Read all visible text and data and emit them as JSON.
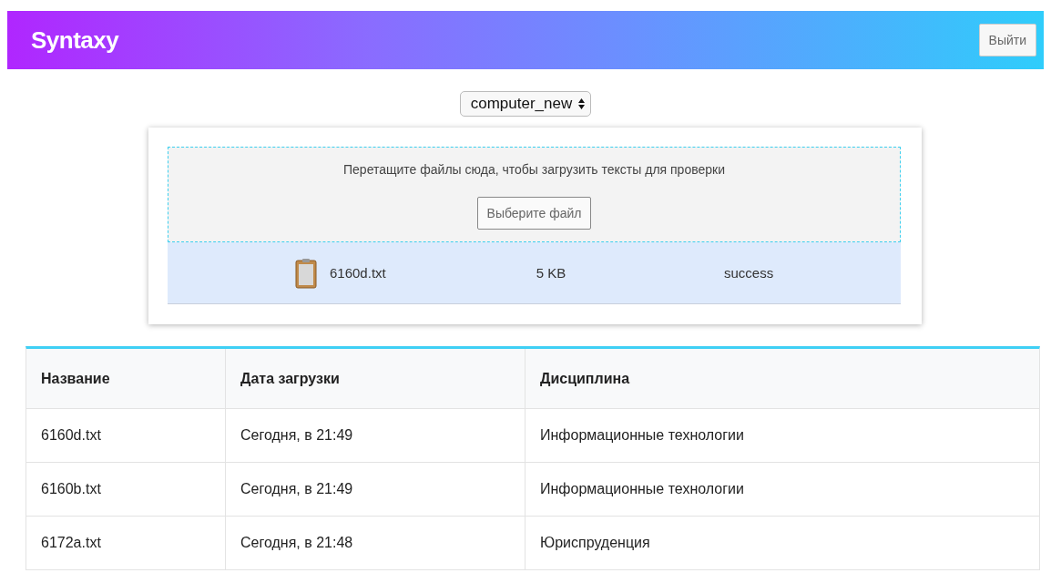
{
  "header": {
    "logo": "Syntaxy",
    "logout_button": "Выйти"
  },
  "database_select": {
    "value": "computer_new"
  },
  "upload": {
    "hint": "Перетащите файлы сюда, чтобы загрузить тексты для проверки",
    "choose_button": "Выберите файл",
    "files": [
      {
        "name": "6160d.txt",
        "size": "5 KB",
        "status": "success"
      }
    ]
  },
  "table": {
    "columns": [
      "Название",
      "Дата загрузки",
      "Дисциплина"
    ],
    "rows": [
      [
        "6160d.txt",
        "Сегодня, в 21:49",
        "Информационные технологии"
      ],
      [
        "6160b.txt",
        "Сегодня, в 21:49",
        "Информационные технологии"
      ],
      [
        "6172a.txt",
        "Сегодня, в 21:48",
        "Юриспруденция"
      ]
    ]
  }
}
